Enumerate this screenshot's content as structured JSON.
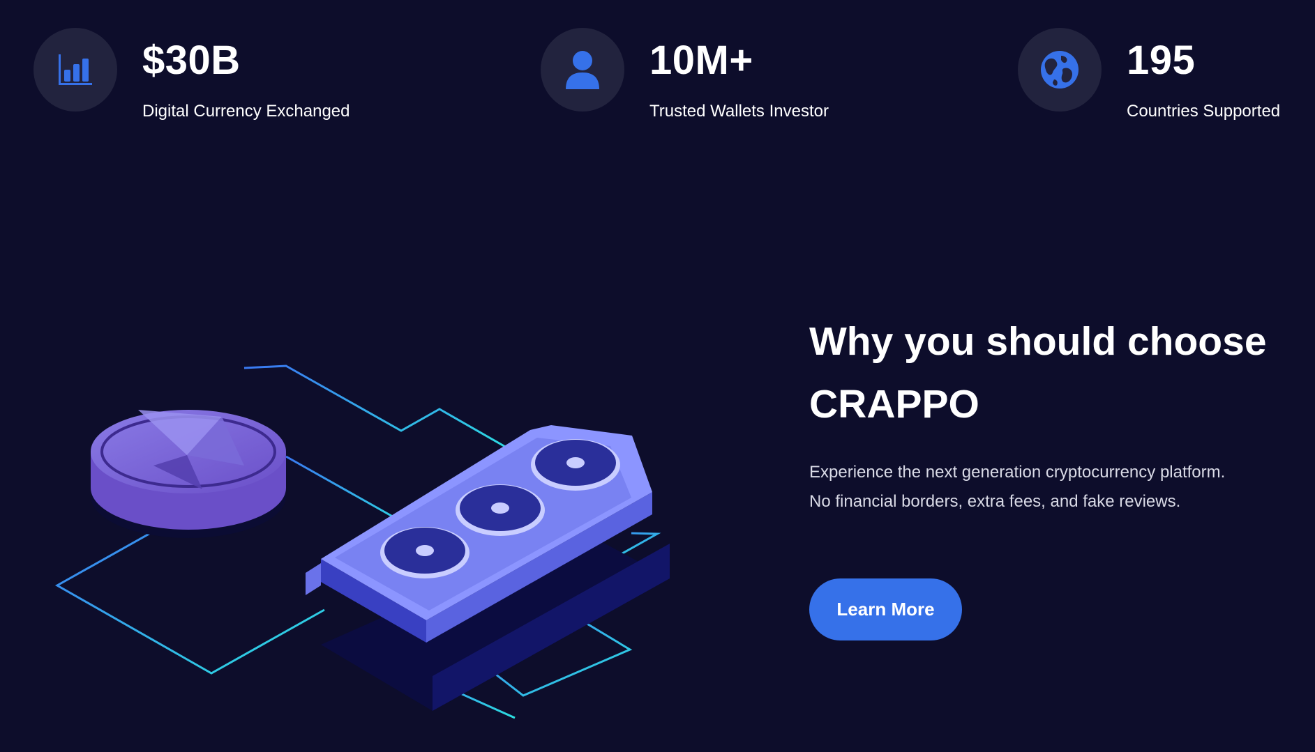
{
  "stats": [
    {
      "icon": "bar-chart-icon",
      "value": "$30B",
      "label": "Digital Currency Exchanged"
    },
    {
      "icon": "user-icon",
      "value": "10M+",
      "label": "Trusted Wallets Investor"
    },
    {
      "icon": "globe-icon",
      "value": "195",
      "label": "Countries Supported"
    }
  ],
  "why": {
    "headline": "Why you should choose CRAPPO",
    "description": "Experience the next generation cryptocurrency platform. No financial borders, extra fees, and fake reviews.",
    "cta_label": "Learn More"
  },
  "colors": {
    "background": "#0d0d2b",
    "icon_circle": "#22233e",
    "accent": "#3671e9",
    "text": "#ffffff"
  }
}
